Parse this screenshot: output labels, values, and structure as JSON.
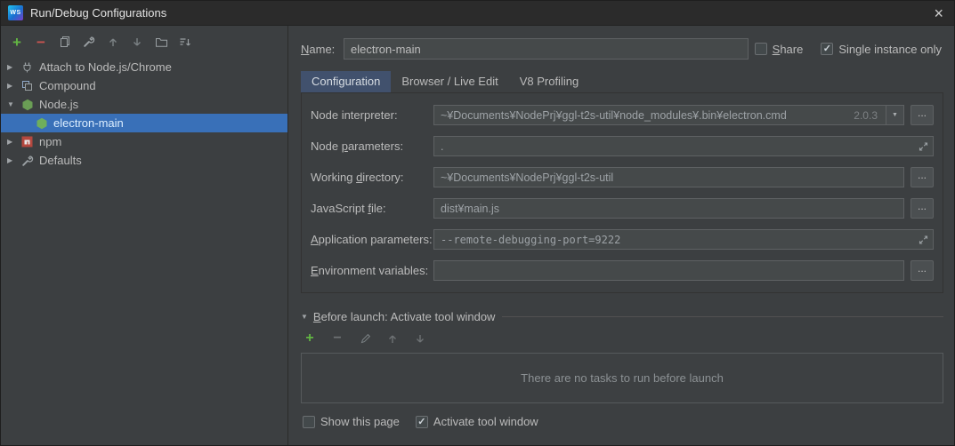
{
  "window": {
    "title": "Run/Debug Configurations",
    "logo_text": "WS"
  },
  "glyphs": {
    "close": "×",
    "check": "✓",
    "chevron_collapsed": "▶",
    "chevron_expanded": "▼",
    "dropdown": "▼",
    "ellipsis": "...",
    "plus": "+",
    "minus": "−"
  },
  "colors": {
    "selection_blue": "#3970b8",
    "accent_green": "#62b543",
    "tab_active": "#41516d",
    "input_background": "#45494a",
    "panel_background": "#3c3f41"
  },
  "sidebar": {
    "toolbar_icons": [
      "add",
      "remove",
      "copy",
      "edit-defaults",
      "move-up",
      "move-down",
      "new-folder",
      "sort"
    ],
    "tree": [
      {
        "label": "Attach to Node.js/Chrome"
      },
      {
        "label": "Compound"
      },
      {
        "label": "Node.js"
      },
      {
        "label": "electron-main",
        "selected": true
      },
      {
        "label": "npm"
      },
      {
        "label": "Defaults"
      }
    ]
  },
  "main": {
    "name_label": "Name:",
    "name_value": "electron-main",
    "share_label": "Share",
    "share_checked": false,
    "single_instance_label": "Single instance only",
    "single_instance_checked": true,
    "tabs": [
      {
        "label": "Configuration",
        "active": true
      },
      {
        "label": "Browser / Live Edit",
        "active": false
      },
      {
        "label": "V8 Profiling",
        "active": false
      }
    ],
    "fields": [
      {
        "label": "Node interpreter:",
        "value": "~¥Documents¥NodePrj¥ggl-t2s-util¥node_modules¥.bin¥electron.cmd",
        "version": "2.0.3"
      },
      {
        "label": "Node parameters:",
        "value": "."
      },
      {
        "label": "Working directory:",
        "value": "~¥Documents¥NodePrj¥ggl-t2s-util"
      },
      {
        "label": "JavaScript file:",
        "value": "dist¥main.js"
      },
      {
        "label": "Application parameters:",
        "value": "--remote-debugging-port=9222"
      },
      {
        "label": "Environment variables:",
        "value": ""
      }
    ],
    "before_launch": {
      "title": "Before launch: Activate tool window",
      "empty_text": "There are no tasks to run before launch"
    },
    "footer": {
      "show_this_page": "Show this page",
      "show_this_page_checked": false,
      "activate_tool_window": "Activate tool window",
      "activate_tool_window_checked": true
    }
  }
}
